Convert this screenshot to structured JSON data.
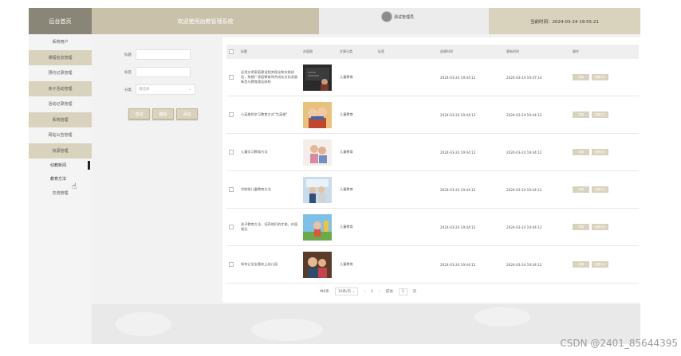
{
  "header": {
    "brand": "后台首页",
    "welcome": "欢迎使用幼教管理系统",
    "user": "测试管理员",
    "time": "当前时间：2024-03-24 19:55:21"
  },
  "sidebar": {
    "items": [
      {
        "label": "系统用户"
      },
      {
        "label": "课程信息管理"
      },
      {
        "label": "预约记录管理"
      },
      {
        "label": "亲子活动管理"
      },
      {
        "label": "活动记录管理"
      },
      {
        "label": "系统管理"
      },
      {
        "label": "网站公告管理"
      },
      {
        "label": "资源管理"
      }
    ],
    "sub_items": [
      {
        "label": "幼教新闻"
      },
      {
        "label": "教育方法"
      }
    ],
    "last_item": "交流管理"
  },
  "filter": {
    "title_label": "标题",
    "title_value": "",
    "tag_label": "标签",
    "tag_value": "",
    "category_label": "分类",
    "category_placeholder": "请选择",
    "query_btn": "查询",
    "delete_btn": "删除",
    "add_btn": "添加"
  },
  "table": {
    "headers": [
      "标题",
      "封面图",
      "文章分类",
      "标签",
      "创建时间",
      "更新时间",
      "操作"
    ],
    "rows": [
      {
        "title": "运用文明家庭建设相关理论和实践经验，构建广家庭教育同共成长文化发展新型与教育理念结构",
        "category": "儿童教育",
        "tag": "",
        "created": "2024-03-24 19:44:12",
        "updated": "2024-03-24 19:47:14"
      },
      {
        "title": "小英雄的学习教育方式\"大英雄\"",
        "category": "儿童教育",
        "tag": "",
        "created": "2024-03-24 19:44:12",
        "updated": "2024-03-24 19:44:12"
      },
      {
        "title": "儿童学习教育方法",
        "category": "儿童教育",
        "tag": "",
        "created": "2024-03-24 19:44:12",
        "updated": "2024-03-24 19:44:12"
      },
      {
        "title": "学龄前儿童教育方法",
        "category": "儿童教育",
        "tag": "",
        "created": "2024-03-24 19:44:12",
        "updated": "2024-03-24 19:44:12"
      },
      {
        "title": "孩子教育方法，培养他们的才能、价值观念",
        "category": "儿童教育",
        "tag": "",
        "created": "2024-03-24 19:44:12",
        "updated": "2024-03-24 19:44:12"
      },
      {
        "title": "如何让宝宝喜欢上幼儿园",
        "category": "儿童教育",
        "tag": "",
        "created": "2024-03-24 19:44:12",
        "updated": "2024-03-24 19:44:12"
      }
    ],
    "op_view": "详情",
    "op_edit": "查看评论"
  },
  "pager": {
    "total": "共6条",
    "per_page": "10条/页",
    "prev": "‹",
    "page": "1",
    "next": "›",
    "goto_label": "前往",
    "goto_value": "1",
    "page_suffix": "页"
  },
  "watermark": "CSDN @2401_85644395",
  "colors": {
    "accent": "#d9d2bd",
    "brand": "#8a8677",
    "banner": "#c9c1aa"
  }
}
